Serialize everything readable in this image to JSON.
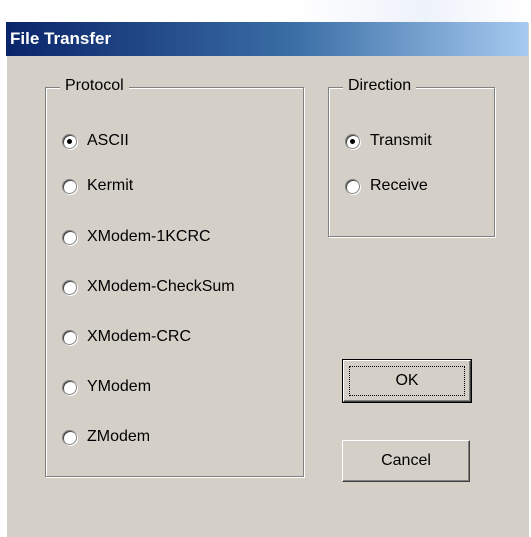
{
  "window": {
    "title": "File Transfer"
  },
  "protocol": {
    "label": "Protocol",
    "selected": "ASCII",
    "options": [
      "ASCII",
      "Kermit",
      "XModem-1KCRC",
      "XModem-CheckSum",
      "XModem-CRC",
      "YModem",
      "ZModem"
    ]
  },
  "direction": {
    "label": "Direction",
    "selected": "Transmit",
    "options": [
      "Transmit",
      "Receive"
    ]
  },
  "buttons": {
    "ok": "OK",
    "cancel": "Cancel"
  },
  "colors": {
    "title_start": "#0a246a",
    "title_end": "#a6caf0",
    "dialog_bg": "#d4d0c8"
  }
}
